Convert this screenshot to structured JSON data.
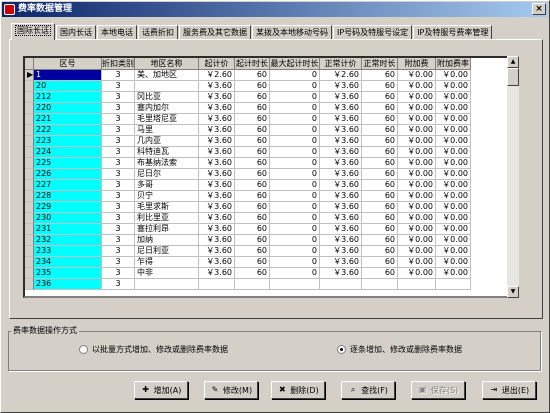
{
  "window": {
    "title": "费率数据管理",
    "close": "×"
  },
  "tabs": [
    "国际长话",
    "国内长话",
    "本地电话",
    "话费折扣",
    "服务费及其它数据",
    "某拨及本地移动号码",
    "IP号码及特服号设定",
    "IP及特服号费率管理"
  ],
  "grid": {
    "columns": [
      "区号",
      "折扣类别",
      "地区名称",
      "起计价",
      "起计时长",
      "最大起计时长",
      "正常计价",
      "正常时长",
      "附加费",
      "附加费率"
    ],
    "rows": [
      [
        "1",
        "3",
        "美、加地区",
        "￥2.60",
        "60",
        "0",
        "￥2.60",
        "60",
        "￥0.00",
        "￥0.00"
      ],
      [
        "20",
        "3",
        "",
        "￥3.60",
        "60",
        "0",
        "￥3.60",
        "60",
        "￥0.00",
        "￥0.00"
      ],
      [
        "212",
        "3",
        "冈比亚",
        "￥3.60",
        "60",
        "0",
        "￥3.60",
        "60",
        "￥0.00",
        "￥0.00"
      ],
      [
        "220",
        "3",
        "塞内加尔",
        "￥3.60",
        "60",
        "0",
        "￥3.60",
        "60",
        "￥0.00",
        "￥0.00"
      ],
      [
        "221",
        "3",
        "毛里塔尼亚",
        "￥3.60",
        "60",
        "0",
        "￥3.60",
        "60",
        "￥0.00",
        "￥0.00"
      ],
      [
        "222",
        "3",
        "马里",
        "￥3.60",
        "60",
        "0",
        "￥3.60",
        "60",
        "￥0.00",
        "￥0.00"
      ],
      [
        "223",
        "3",
        "几内亚",
        "￥3.60",
        "60",
        "0",
        "￥3.60",
        "60",
        "￥0.00",
        "￥0.00"
      ],
      [
        "224",
        "3",
        "科特迪瓦",
        "￥3.60",
        "60",
        "0",
        "￥3.60",
        "60",
        "￥0.00",
        "￥0.00"
      ],
      [
        "225",
        "3",
        "布基纳法索",
        "￥3.60",
        "60",
        "0",
        "￥3.60",
        "60",
        "￥0.00",
        "￥0.00"
      ],
      [
        "226",
        "3",
        "尼日尔",
        "￥3.60",
        "60",
        "0",
        "￥3.60",
        "60",
        "￥0.00",
        "￥0.00"
      ],
      [
        "227",
        "3",
        "多哥",
        "￥3.60",
        "60",
        "0",
        "￥3.60",
        "60",
        "￥0.00",
        "￥0.00"
      ],
      [
        "228",
        "3",
        "贝宁",
        "￥3.60",
        "60",
        "0",
        "￥3.60",
        "60",
        "￥0.00",
        "￥0.00"
      ],
      [
        "229",
        "3",
        "毛里求斯",
        "￥3.60",
        "60",
        "0",
        "￥3.60",
        "60",
        "￥0.00",
        "￥0.00"
      ],
      [
        "230",
        "3",
        "利比里亚",
        "￥3.60",
        "60",
        "0",
        "￥3.60",
        "60",
        "￥0.00",
        "￥0.00"
      ],
      [
        "231",
        "3",
        "塞拉利昂",
        "￥3.60",
        "60",
        "0",
        "￥3.60",
        "60",
        "￥0.00",
        "￥0.00"
      ],
      [
        "232",
        "3",
        "加纳",
        "￥3.60",
        "60",
        "0",
        "￥3.60",
        "60",
        "￥0.00",
        "￥0.00"
      ],
      [
        "233",
        "3",
        "尼日利亚",
        "￥3.60",
        "60",
        "0",
        "￥3.60",
        "60",
        "￥0.00",
        "￥0.00"
      ],
      [
        "234",
        "3",
        "乍得",
        "￥3.60",
        "60",
        "0",
        "￥3.60",
        "60",
        "￥0.00",
        "￥0.00"
      ],
      [
        "235",
        "3",
        "中非",
        "￥3.60",
        "60",
        "0",
        "￥3.60",
        "60",
        "￥0.00",
        "￥0.00"
      ],
      [
        "236",
        "3",
        "",
        "",
        "",
        "",
        "",
        "",
        "",
        ""
      ]
    ]
  },
  "ops": {
    "group_title": "费率数据操作方式",
    "batch": "以批量方式增加、修改或删除费率数据",
    "single": "逐条增加、修改或删除费率数据",
    "selected": "single"
  },
  "buttons": {
    "add": "增加(A)",
    "edit": "修改(M)",
    "delete": "删除(D)",
    "find": "查找(F)",
    "save": "保存(S)",
    "exit": "退出(E)"
  }
}
